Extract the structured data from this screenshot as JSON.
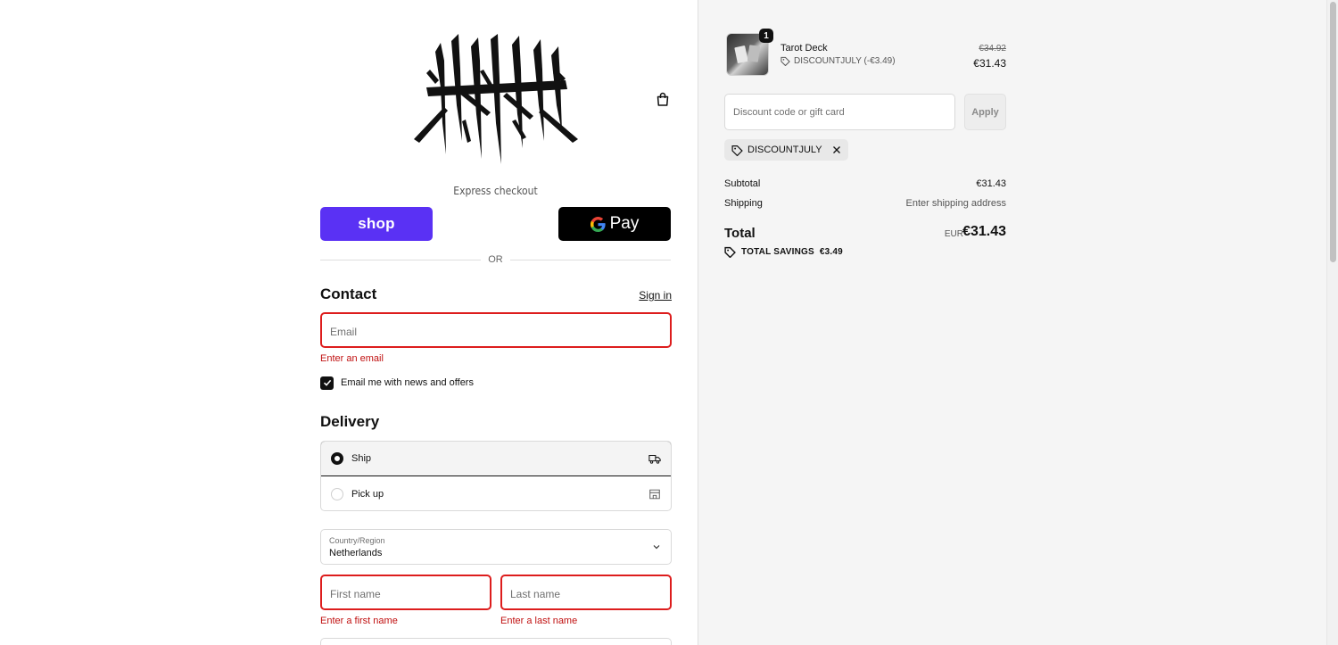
{
  "header": {
    "brand": "HANA",
    "cart_icon": "shopping-bag-icon"
  },
  "express": {
    "label": "Express checkout",
    "shop_pay_label": "shop",
    "gpay_label": "Pay",
    "divider": "OR"
  },
  "contact": {
    "title": "Contact",
    "sign_in": "Sign in",
    "email_placeholder": "Email",
    "email_error": "Enter an email",
    "newsletter_label": "Email me with news and offers",
    "newsletter_checked": true
  },
  "delivery": {
    "title": "Delivery",
    "options": [
      {
        "label": "Ship",
        "icon": "truck-icon",
        "selected": true
      },
      {
        "label": "Pick up",
        "icon": "store-icon",
        "selected": false
      }
    ],
    "country_label": "Country/Region",
    "country_value": "Netherlands",
    "first_name_placeholder": "First name",
    "first_name_error": "Enter a first name",
    "last_name_placeholder": "Last name",
    "last_name_error": "Enter a last name"
  },
  "summary": {
    "product": {
      "name": "Tarot Deck",
      "quantity": "1",
      "discount": "DISCOUNTJULY (-€3.49)",
      "original_price": "€34.92",
      "price": "€31.43"
    },
    "discount_placeholder": "Discount code or gift card",
    "apply_label": "Apply",
    "applied_code": "DISCOUNTJULY",
    "subtotal_label": "Subtotal",
    "subtotal_value": "€31.43",
    "shipping_label": "Shipping",
    "shipping_value": "Enter shipping address",
    "total_label": "Total",
    "currency": "EUR",
    "total_value": "€31.43",
    "savings_label": "TOTAL SAVINGS",
    "savings_value": "€3.49"
  },
  "colors": {
    "shop_pay": "#5a31f4",
    "error": "#dd1d1d",
    "summary_bg": "#f5f5f5"
  }
}
